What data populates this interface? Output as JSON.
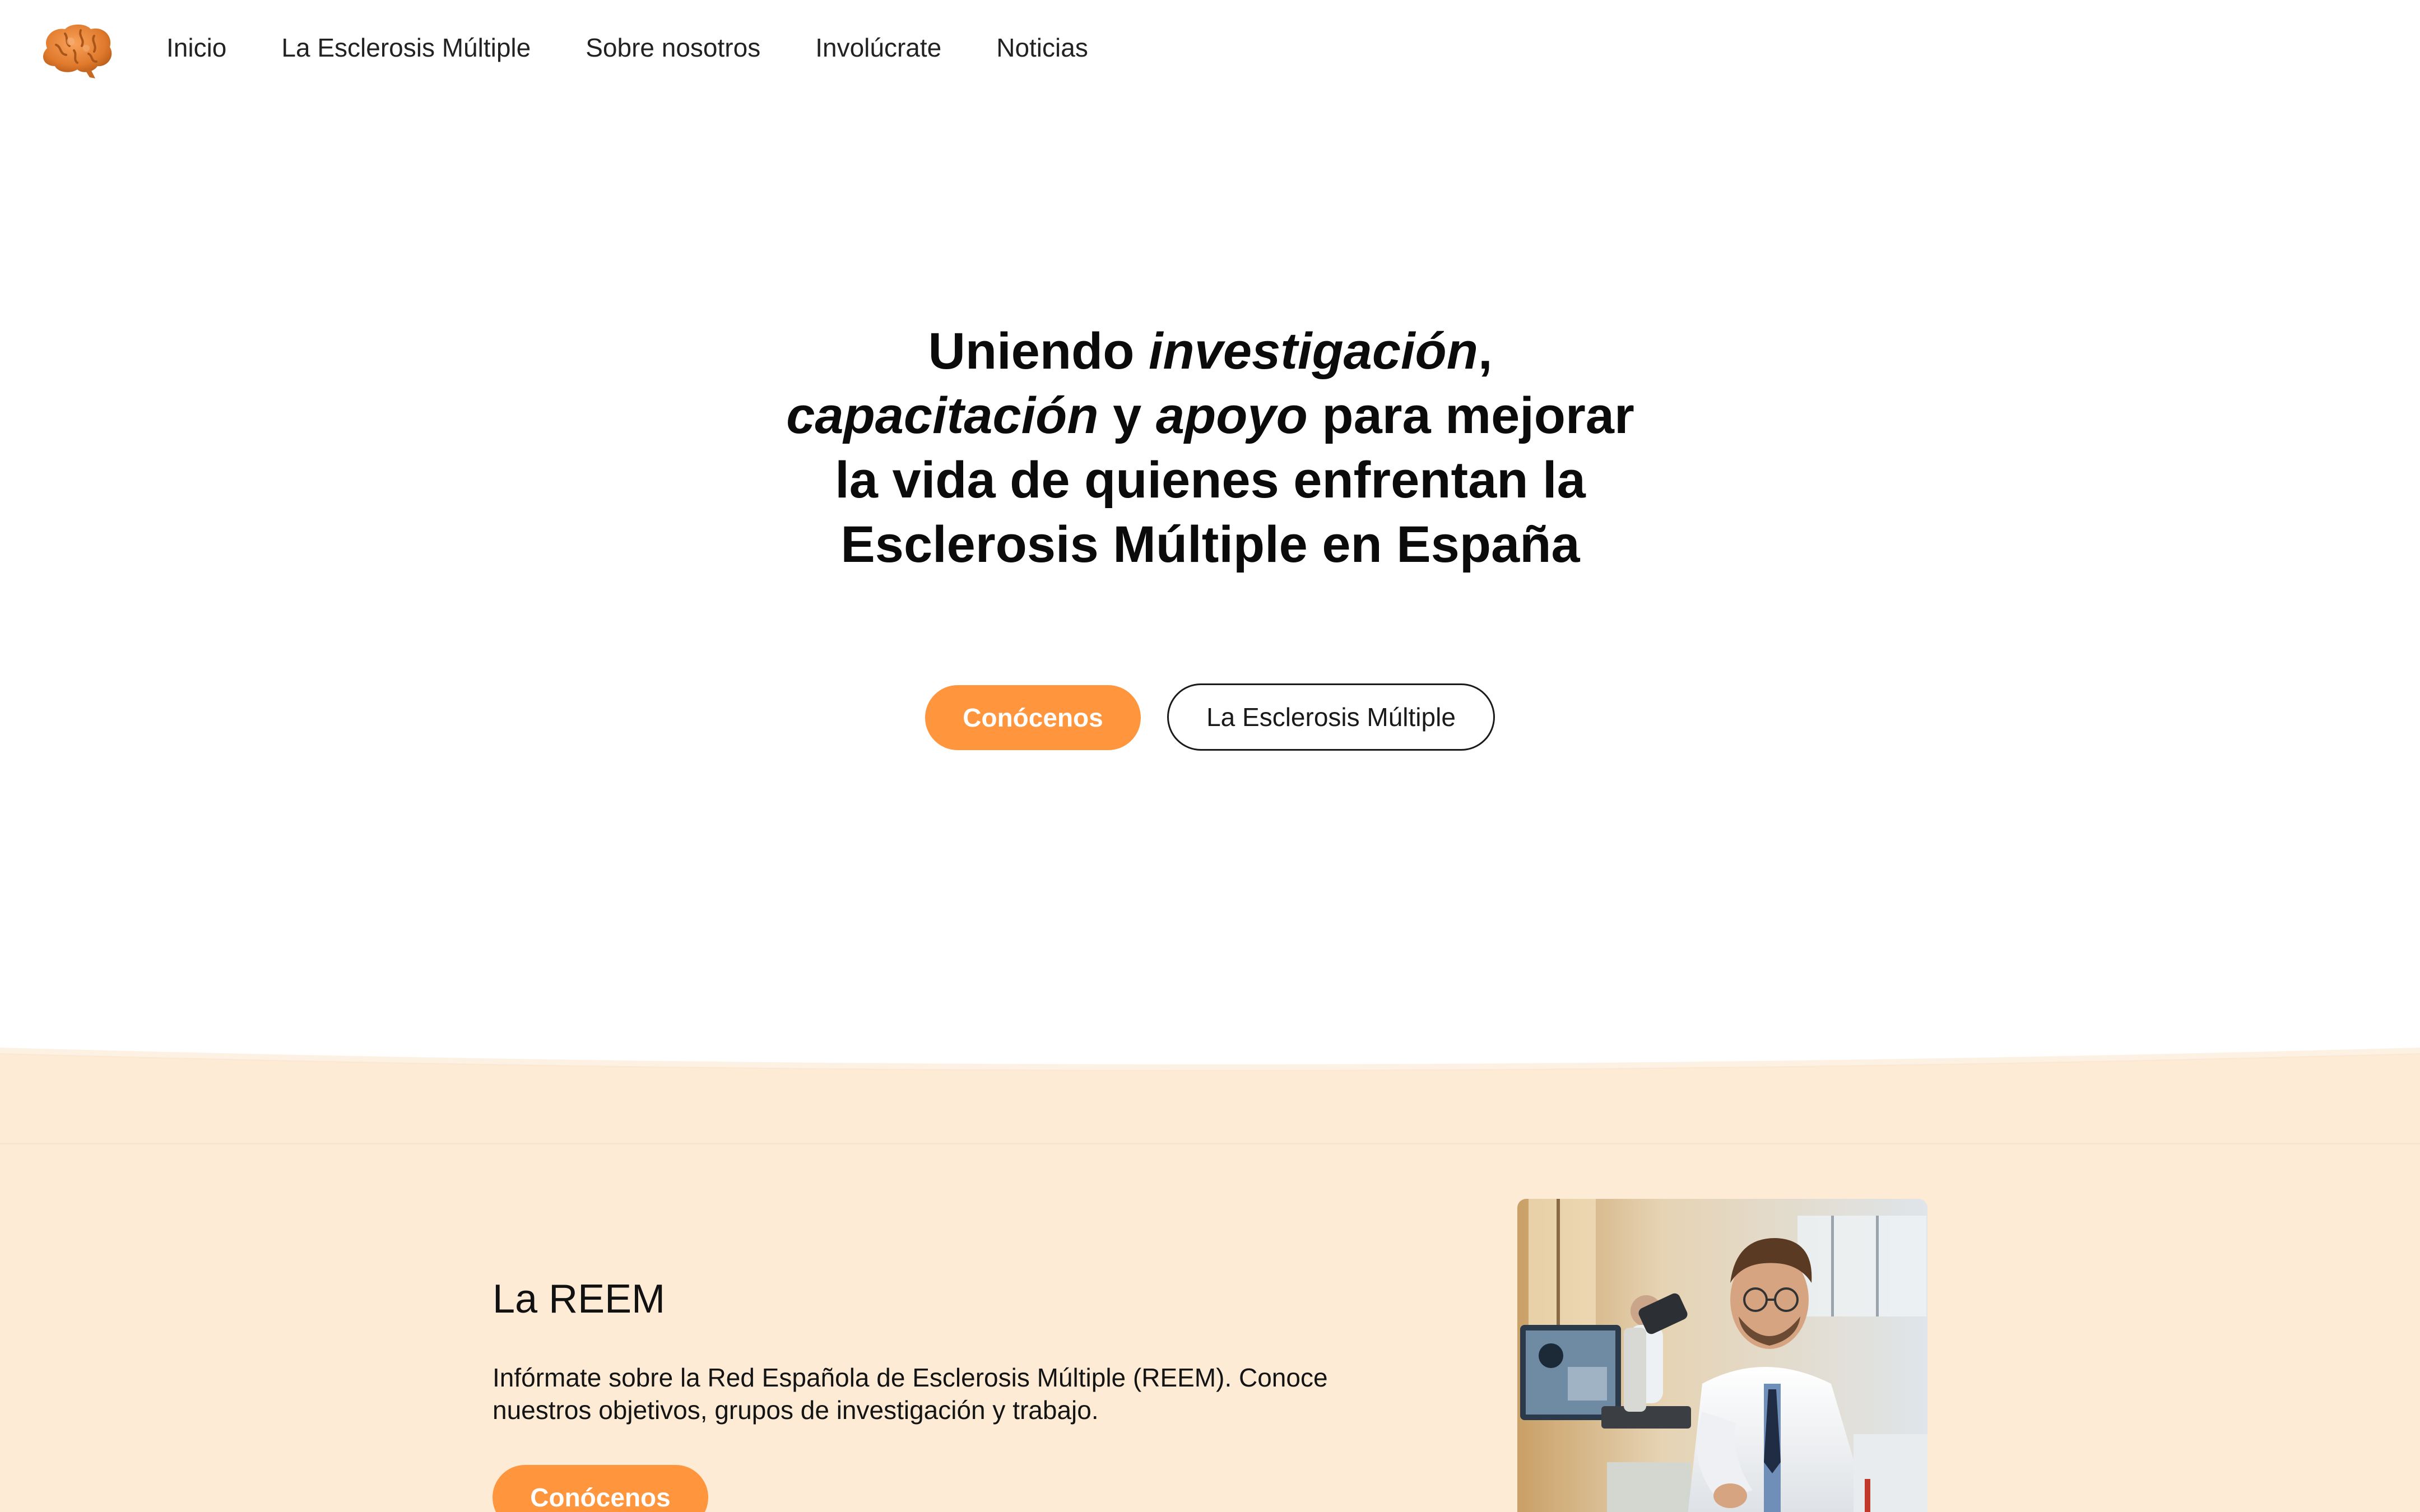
{
  "nav": {
    "logo_icon": "brain-puzzle-icon",
    "links": [
      {
        "label": "Inicio"
      },
      {
        "label": "La Esclerosis Múltiple"
      },
      {
        "label": "Sobre nosotros"
      },
      {
        "label": "Involúcrate"
      },
      {
        "label": "Noticias"
      }
    ]
  },
  "hero": {
    "title_parts": {
      "p1": "Uniendo ",
      "p2": "investigación",
      "p3": ",",
      "p4": "capacitación",
      "p5": " y ",
      "p6": "apoyo",
      "p7": " para mejorar",
      "p8": "la vida de quienes enfrentan la",
      "p9": "Esclerosis Múltiple en España"
    },
    "primary_button": "Conócenos",
    "secondary_button": "La Esclerosis Múltiple"
  },
  "reem": {
    "title": "La REEM",
    "text_line1": "Infórmate sobre la Red Española de Esclerosis Múltiple (REEM). Conoce",
    "text_line2": "nuestros objetivos, grupos de investigación y trabajo.",
    "button": "Conócenos",
    "image_icon": "scientist-microscope-photo"
  },
  "colors": {
    "accent": "#ff953d",
    "section_bg": "#fdebd6",
    "text": "#111111"
  }
}
